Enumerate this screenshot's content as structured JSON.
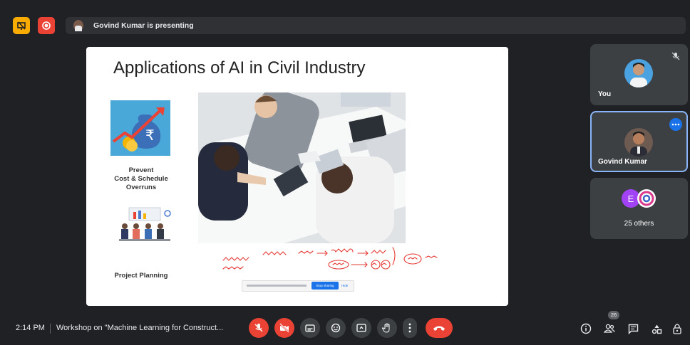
{
  "topbar": {
    "presenting_text": "Govind Kumar is presenting"
  },
  "slide": {
    "title": "Applications of AI in Civil Industry",
    "caption1_line1": "Prevent",
    "caption1_line2": "Cost & Schedule",
    "caption1_line3": "Overruns",
    "caption2": "Project Planning",
    "stop_button_label": "Stop sharing",
    "hide_label": "Hide"
  },
  "tiles": {
    "you_label": "You",
    "presenter_label": "Govind Kumar",
    "others_initial": "E",
    "others_label": "25 others"
  },
  "bottombar": {
    "time": "2:14 PM",
    "meeting_title": "Workshop on \"Machine Learning for Construct...",
    "participants_badge": "26"
  },
  "colors": {
    "red": "#ea4335",
    "yellow": "#f9ab00",
    "blue": "#1a73e8",
    "tile_bg": "#3c4043"
  }
}
